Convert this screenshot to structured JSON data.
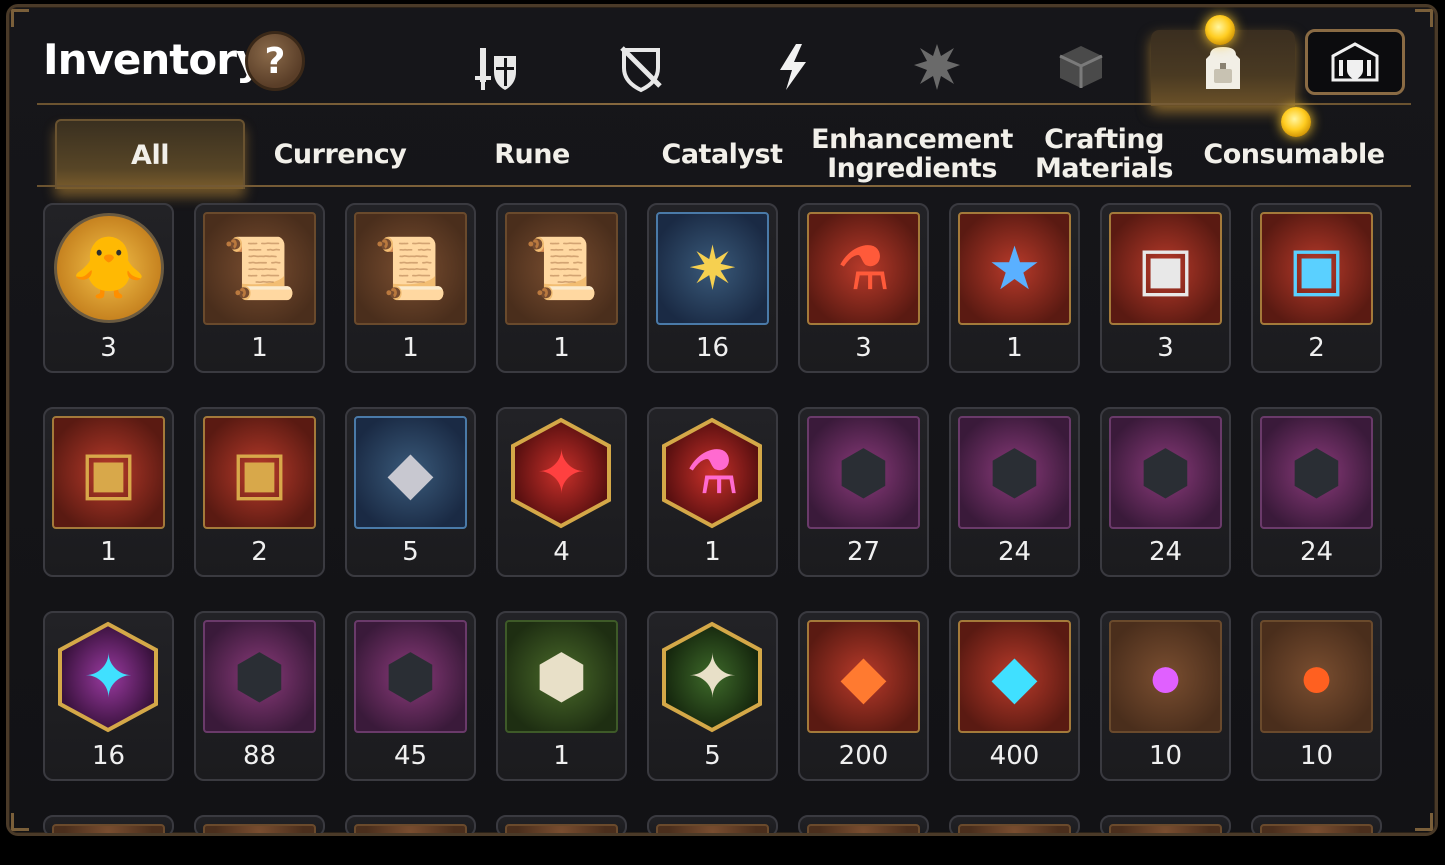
{
  "header": {
    "title": "Inventory",
    "help_label": "?"
  },
  "category_icons": [
    {
      "name": "gear-icon",
      "active": false
    },
    {
      "name": "disabled-gear-icon",
      "active": false
    },
    {
      "name": "lightning-icon",
      "active": false
    },
    {
      "name": "burst-icon",
      "active": false
    },
    {
      "name": "cube-icon",
      "active": false
    },
    {
      "name": "backpack-icon",
      "active": true
    },
    {
      "name": "guild-storage-icon",
      "active": false
    }
  ],
  "tabs": [
    {
      "label": "All",
      "active": true
    },
    {
      "label": "Currency",
      "active": false
    },
    {
      "label": "Rune",
      "active": false
    },
    {
      "label": "Catalyst",
      "active": false
    },
    {
      "label": "Enhancement Ingredients",
      "active": false
    },
    {
      "label": "Crafting Materials",
      "active": false
    },
    {
      "label": "Consumable",
      "active": false,
      "notification": true
    }
  ],
  "items": [
    {
      "icon": "phoenix-chick-portrait",
      "count": "3",
      "frame": "round"
    },
    {
      "icon": "scroll-red-upgrade",
      "count": "1",
      "frame": "brown"
    },
    {
      "icon": "scroll-rainbow-upgrade",
      "count": "1",
      "frame": "brown"
    },
    {
      "icon": "scroll-gold-upgrade",
      "count": "1",
      "frame": "brown"
    },
    {
      "icon": "gold-crystal-cluster",
      "count": "16",
      "frame": "blue"
    },
    {
      "icon": "red-potion-flask",
      "count": "3",
      "frame": "red"
    },
    {
      "icon": "star-potion-flask",
      "count": "1",
      "frame": "red"
    },
    {
      "icon": "silver-chest",
      "count": "3",
      "frame": "red"
    },
    {
      "icon": "blue-crystal-chest",
      "count": "2",
      "frame": "red"
    },
    {
      "icon": "dark-gold-chest",
      "count": "1",
      "frame": "red"
    },
    {
      "icon": "dark-gold-chest",
      "count": "2",
      "frame": "red"
    },
    {
      "icon": "silver-cube",
      "count": "5",
      "frame": "blue"
    },
    {
      "icon": "red-rune-stone",
      "count": "4",
      "frame": "hex-red"
    },
    {
      "icon": "pink-potion",
      "count": "1",
      "frame": "hex-red"
    },
    {
      "icon": "sword-rune-stone",
      "count": "27",
      "frame": "purple"
    },
    {
      "icon": "swirl-rune-stone",
      "count": "24",
      "frame": "purple"
    },
    {
      "icon": "armor-rune-stone",
      "count": "24",
      "frame": "purple"
    },
    {
      "icon": "boot-rune-stone",
      "count": "24",
      "frame": "purple"
    },
    {
      "icon": "cross-rune-stone",
      "count": "16",
      "frame": "hex-purple"
    },
    {
      "icon": "hammer-rune-stone",
      "count": "88",
      "frame": "purple"
    },
    {
      "icon": "lightning-rune-stone",
      "count": "45",
      "frame": "purple"
    },
    {
      "icon": "pale-sword-stone",
      "count": "1",
      "frame": "green"
    },
    {
      "icon": "pale-cross-stone",
      "count": "5",
      "frame": "hex-green"
    },
    {
      "icon": "ember-shard",
      "count": "200",
      "frame": "red"
    },
    {
      "icon": "cyan-crystal-shard",
      "count": "400",
      "frame": "red"
    },
    {
      "icon": "purple-orb-gem",
      "count": "10",
      "frame": "brown"
    },
    {
      "icon": "fire-orb-gem",
      "count": "10",
      "frame": "brown"
    }
  ],
  "partial_row_count": 9,
  "colors": {
    "accent_gold": "#ffcc20",
    "frame_border": "#4a3a28",
    "background": "#141417"
  }
}
